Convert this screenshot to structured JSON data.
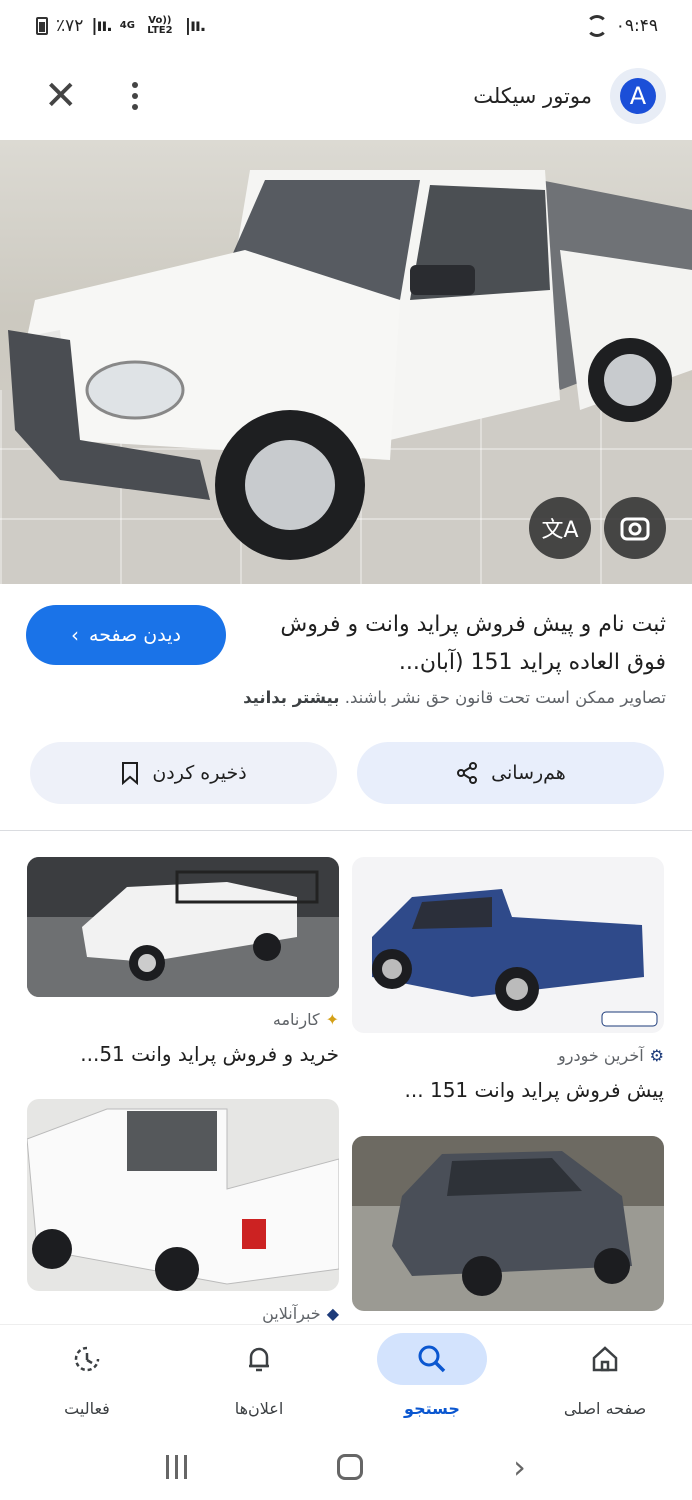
{
  "status_bar": {
    "battery": "٪۷۲",
    "network": "4G",
    "network2": "Vo)) LTE2",
    "time": "۰۹:۴۹"
  },
  "header": {
    "title": "موتور سیکلت",
    "avatar_letter": "A"
  },
  "result": {
    "title": "ثبت نام و پیش فروش پراید وانت و فروش فوق العاده پراید 151 (آبان...",
    "view_page_label": "دیدن صفحه",
    "copyright_text": "تصاویر ممکن است تحت قانون حق نشر باشند.",
    "learn_more": "بیشتر بدانید",
    "share_label": "هم‌رسانی",
    "save_label": "ذخیره کردن"
  },
  "grid": [
    {
      "source": "آخرین خودرو",
      "caption": "پیش فروش پراید وانت 151 ..."
    },
    {
      "source": "کارنامه",
      "caption": "خرید و فروش پراید وانت 51..."
    },
    {
      "source": "",
      "caption": ""
    },
    {
      "source": "خبرآنلاین",
      "caption": ""
    }
  ],
  "bottom_nav": [
    {
      "label": "صفحه اصلی",
      "icon": "home-icon"
    },
    {
      "label": "جستجو",
      "icon": "search-icon"
    },
    {
      "label": "اعلان‌ها",
      "icon": "bell-icon"
    },
    {
      "label": "فعالیت",
      "icon": "activity-icon"
    }
  ],
  "colors": {
    "accent": "#1a73e8",
    "active_nav_pill": "#d3e3fd"
  }
}
